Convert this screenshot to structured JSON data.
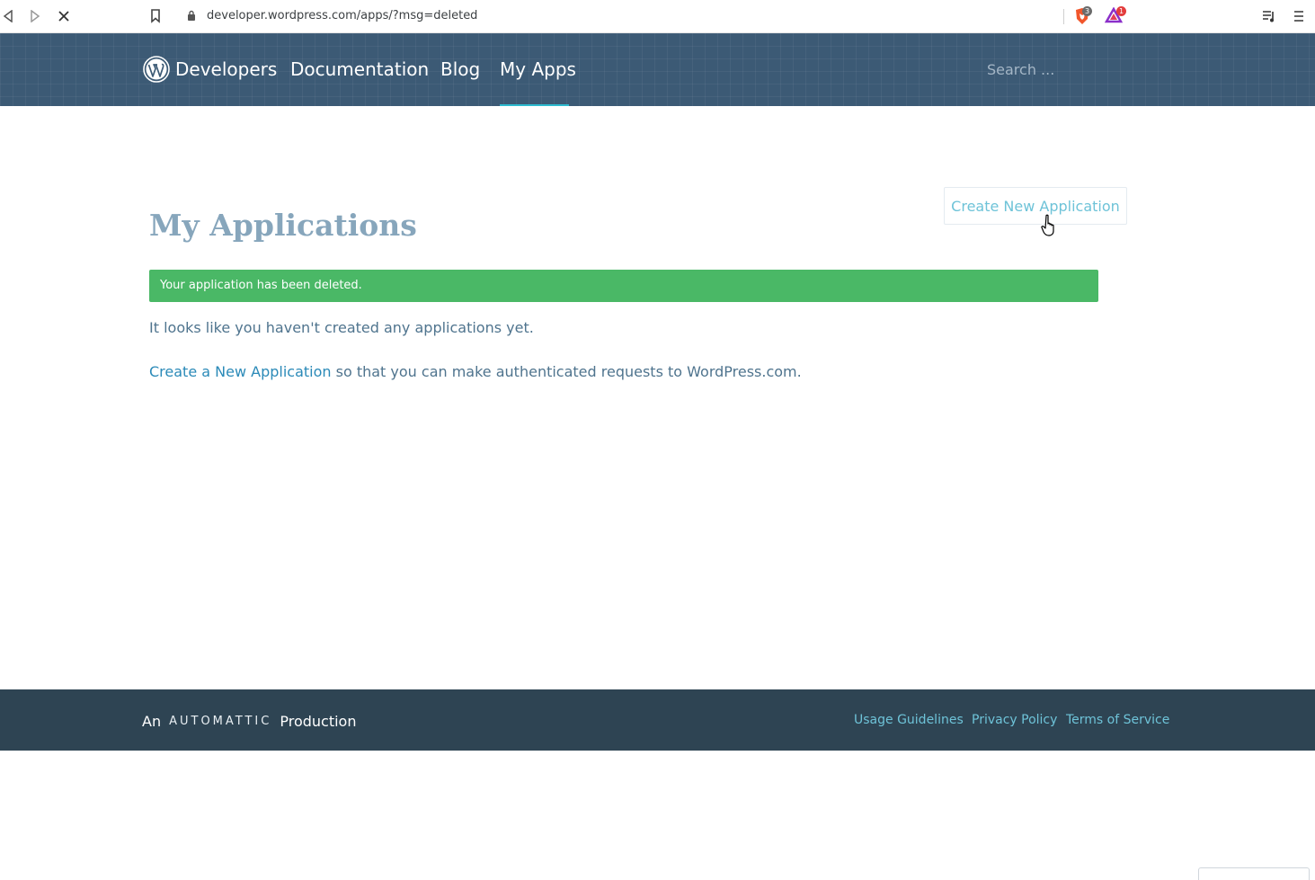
{
  "browser": {
    "url": "developer.wordpress.com/apps/?msg=deleted",
    "brave_badge": "3",
    "rewards_badge": "1"
  },
  "header": {
    "site_title": "Developers",
    "nav": [
      {
        "label": "Documentation"
      },
      {
        "label": "Blog"
      },
      {
        "label": "My Apps"
      }
    ],
    "search_placeholder": "Search ..."
  },
  "main": {
    "title": "My Applications",
    "create_button": "Create New Application",
    "notice": "Your application has been deleted.",
    "empty_message": "It looks like you haven't created any applications yet.",
    "cta_link": "Create a New Application",
    "cta_rest": " so that you can make authenticated requests to WordPress.com."
  },
  "footer": {
    "prefix": "An",
    "brand": "AUTOMATTIC",
    "suffix": "Production",
    "links": [
      {
        "label": "Usage Guidelines"
      },
      {
        "label": "Privacy Policy"
      },
      {
        "label": "Terms of Service"
      }
    ]
  },
  "colors": {
    "header_bg": "#3c5a75",
    "accent": "#2ebbd0",
    "notice_green": "#4ab866",
    "footer_bg": "#2e4453",
    "link": "#2b8ab8"
  }
}
